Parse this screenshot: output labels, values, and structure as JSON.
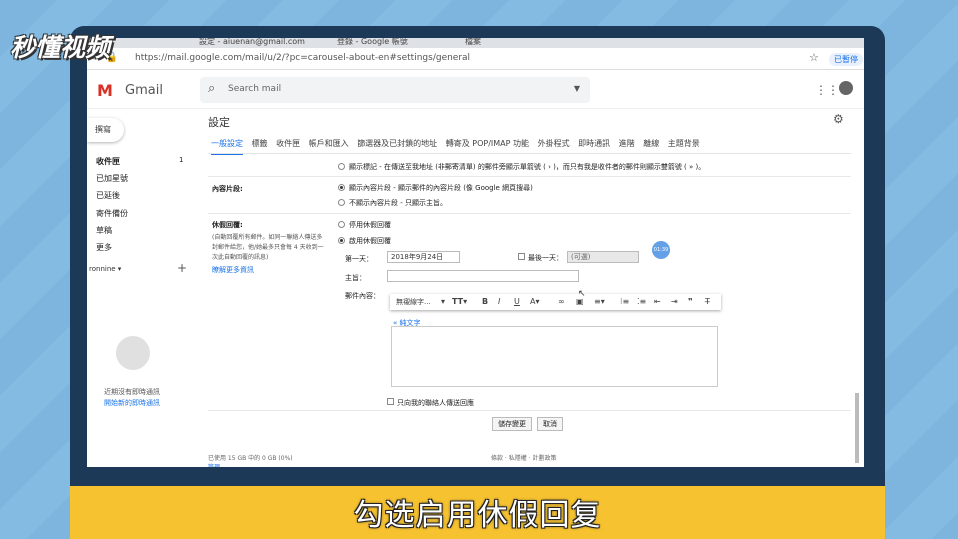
{
  "watermark": {
    "logo_text": "秒懂视频"
  },
  "caption": "勾选启用休假回复",
  "browser": {
    "tabs": [
      "設定 - aiuenan@gmail.com",
      "登錄 - Google 帳號",
      "檔案"
    ],
    "url": "https://mail.google.com/mail/u/2/?pc=carousel-about-en#settings/general",
    "paused_label": "已暫停"
  },
  "gmail": {
    "logo": "M",
    "product": "Gmail",
    "search_placeholder": "Search mail"
  },
  "sidebar": {
    "compose": "撰寫",
    "items": [
      {
        "label": "收件匣",
        "count": "1"
      },
      {
        "label": "已加星號",
        "count": ""
      },
      {
        "label": "已延後",
        "count": ""
      },
      {
        "label": "寄件備份",
        "count": ""
      },
      {
        "label": "草稿",
        "count": ""
      },
      {
        "label": "更多",
        "count": ""
      }
    ],
    "user": "ronnine ▾",
    "plus": "+",
    "chat_empty": "近期沒有即時通訊",
    "chat_link": "開始新的即時通訊"
  },
  "settings": {
    "title": "設定",
    "tabs": [
      "一般設定",
      "標籤",
      "收件匣",
      "帳戶和匯入",
      "篩選器及已封鎖的地址",
      "轉寄及 POP/IMAP 功能",
      "外掛程式",
      "即時通訊",
      "進階",
      "離線",
      "主題背景"
    ],
    "personal_indicator": "顯示標記 - 在傳送至我地址 (非郵寄清單) 的郵件旁顯示單箭號 ( › )，而只有我是收件者的郵件則顯示雙箭號 ( » )。",
    "snippets_label": "內容片段:",
    "snippets_on": "顯示內容片段 - 顯示郵件的內容片段 (像 Google 網頁搜尋)",
    "snippets_off": "不顯示內容片段 - 只顯示主旨。",
    "vacation_label": "休假回覆:",
    "vacation_desc": [
      "(自動回覆所有郵件。如同一聯絡人傳送多",
      "封郵件給您，他/她最多只會每 4 天收到一",
      "次此自動回覆的訊息)"
    ],
    "vacation_learn": "瞭解更多資訊",
    "vacation_off": "停用休假回覆",
    "vacation_on": "啟用休假回覆",
    "first_day_label": "第一天：",
    "first_day_value": "2018年9月24日",
    "last_day_label": "最後一天：",
    "last_day_placeholder": "(可選)",
    "subject_label": "主旨：",
    "body_label": "郵件內容：",
    "font_select": "無襯線字...",
    "plain_text": "« 純文字",
    "contacts_only": "只向我的聯絡人傳送回應",
    "save": "儲存變更",
    "cancel": "取消",
    "storage": "已使用 15 GB 中的 0 GB (0%)",
    "manage": "管理",
    "terms": "條款 · 私隱權 · 計劃政策",
    "timer": "01:39"
  }
}
